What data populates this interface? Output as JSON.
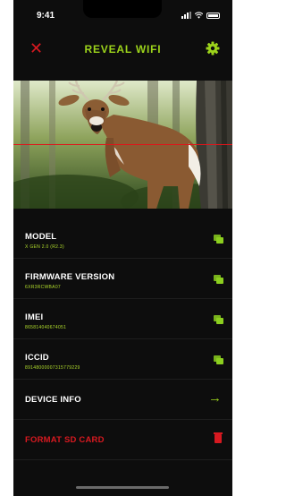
{
  "status_bar": {
    "time": "9:41"
  },
  "header": {
    "title": "REVEAL WIFI",
    "close_icon": "close-icon",
    "settings_icon": "gear-icon"
  },
  "colors": {
    "accent": "#9cd31b",
    "danger": "#d71920",
    "background": "#0d0d0d"
  },
  "rows": [
    {
      "label": "MODEL",
      "value": "X GEN 2.0 (R2.3)"
    },
    {
      "label": "FIRMWARE VERSION",
      "value": "6XR3RCWBA07"
    },
    {
      "label": "IMEI",
      "value": "865814040674051"
    },
    {
      "label": "ICCID",
      "value": "89148000007315779229"
    }
  ],
  "device_info": {
    "label": "DEVICE INFO"
  },
  "format": {
    "label": "FORMAT SD CARD"
  }
}
